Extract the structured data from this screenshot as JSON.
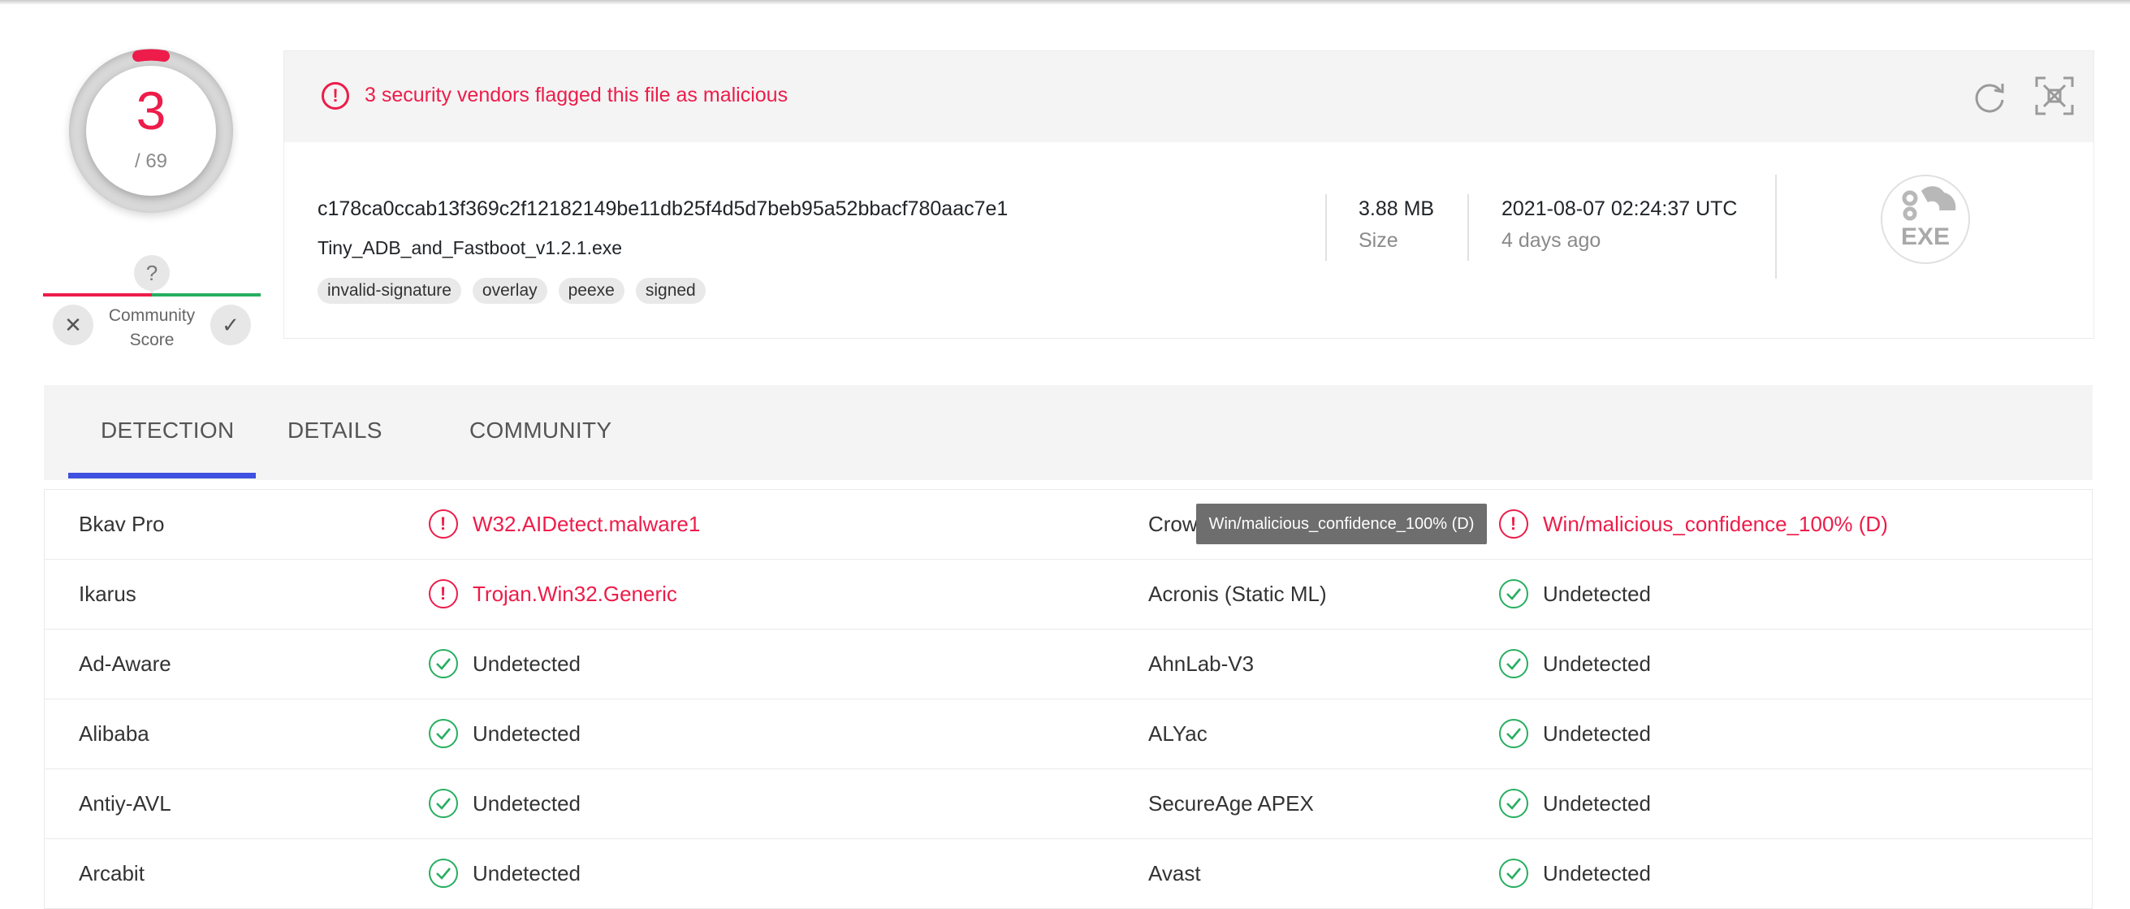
{
  "score": {
    "detections": "3",
    "total": "/ 69"
  },
  "community": {
    "question_mark": "?",
    "label_line1": "Community",
    "label_line2": "Score"
  },
  "alert": {
    "text": "3 security vendors flagged this file as malicious",
    "color": "#ed1c4a"
  },
  "file": {
    "hash": "c178ca0ccab13f369c2f12182149be11db25f4d5d7beb95a52bbacf780aac7e1",
    "name": "Tiny_ADB_and_Fastboot_v1.2.1.exe",
    "tags": [
      "invalid-signature",
      "overlay",
      "peexe",
      "signed"
    ],
    "size_value": "3.88 MB",
    "size_label": "Size",
    "date_value": "2021-08-07 02:24:37 UTC",
    "date_relative": "4 days ago",
    "type_badge": "EXE"
  },
  "tabs": [
    {
      "label": "DETECTION",
      "active": true
    },
    {
      "label": "DETAILS",
      "active": false
    },
    {
      "label": "COMMUNITY",
      "active": false
    }
  ],
  "tooltip": "Win/malicious_confidence_100% (D)",
  "detections": [
    {
      "left_vendor": "Bkav Pro",
      "left_result": "W32.AIDetect.malware1",
      "left_malicious": true,
      "right_vendor": "Crow",
      "right_result": "Win/malicious_confidence_100% (D)",
      "right_malicious": true
    },
    {
      "left_vendor": "Ikarus",
      "left_result": "Trojan.Win32.Generic",
      "left_malicious": true,
      "right_vendor": "Acronis (Static ML)",
      "right_result": "Undetected",
      "right_malicious": false
    },
    {
      "left_vendor": "Ad-Aware",
      "left_result": "Undetected",
      "left_malicious": false,
      "right_vendor": "AhnLab-V3",
      "right_result": "Undetected",
      "right_malicious": false
    },
    {
      "left_vendor": "Alibaba",
      "left_result": "Undetected",
      "left_malicious": false,
      "right_vendor": "ALYac",
      "right_result": "Undetected",
      "right_malicious": false
    },
    {
      "left_vendor": "Antiy-AVL",
      "left_result": "Undetected",
      "left_malicious": false,
      "right_vendor": "SecureAge APEX",
      "right_result": "Undetected",
      "right_malicious": false
    },
    {
      "left_vendor": "Arcabit",
      "left_result": "Undetected",
      "left_malicious": false,
      "right_vendor": "Avast",
      "right_result": "Undetected",
      "right_malicious": false
    }
  ],
  "colors": {
    "malicious": "#ed1c4a",
    "clean": "#27ae60",
    "tab_accent": "#3f51e0"
  },
  "icons": {
    "reload": "reload-icon",
    "expand": "expand-icon",
    "alert": "alert-icon",
    "exe": "exe-file-icon"
  }
}
